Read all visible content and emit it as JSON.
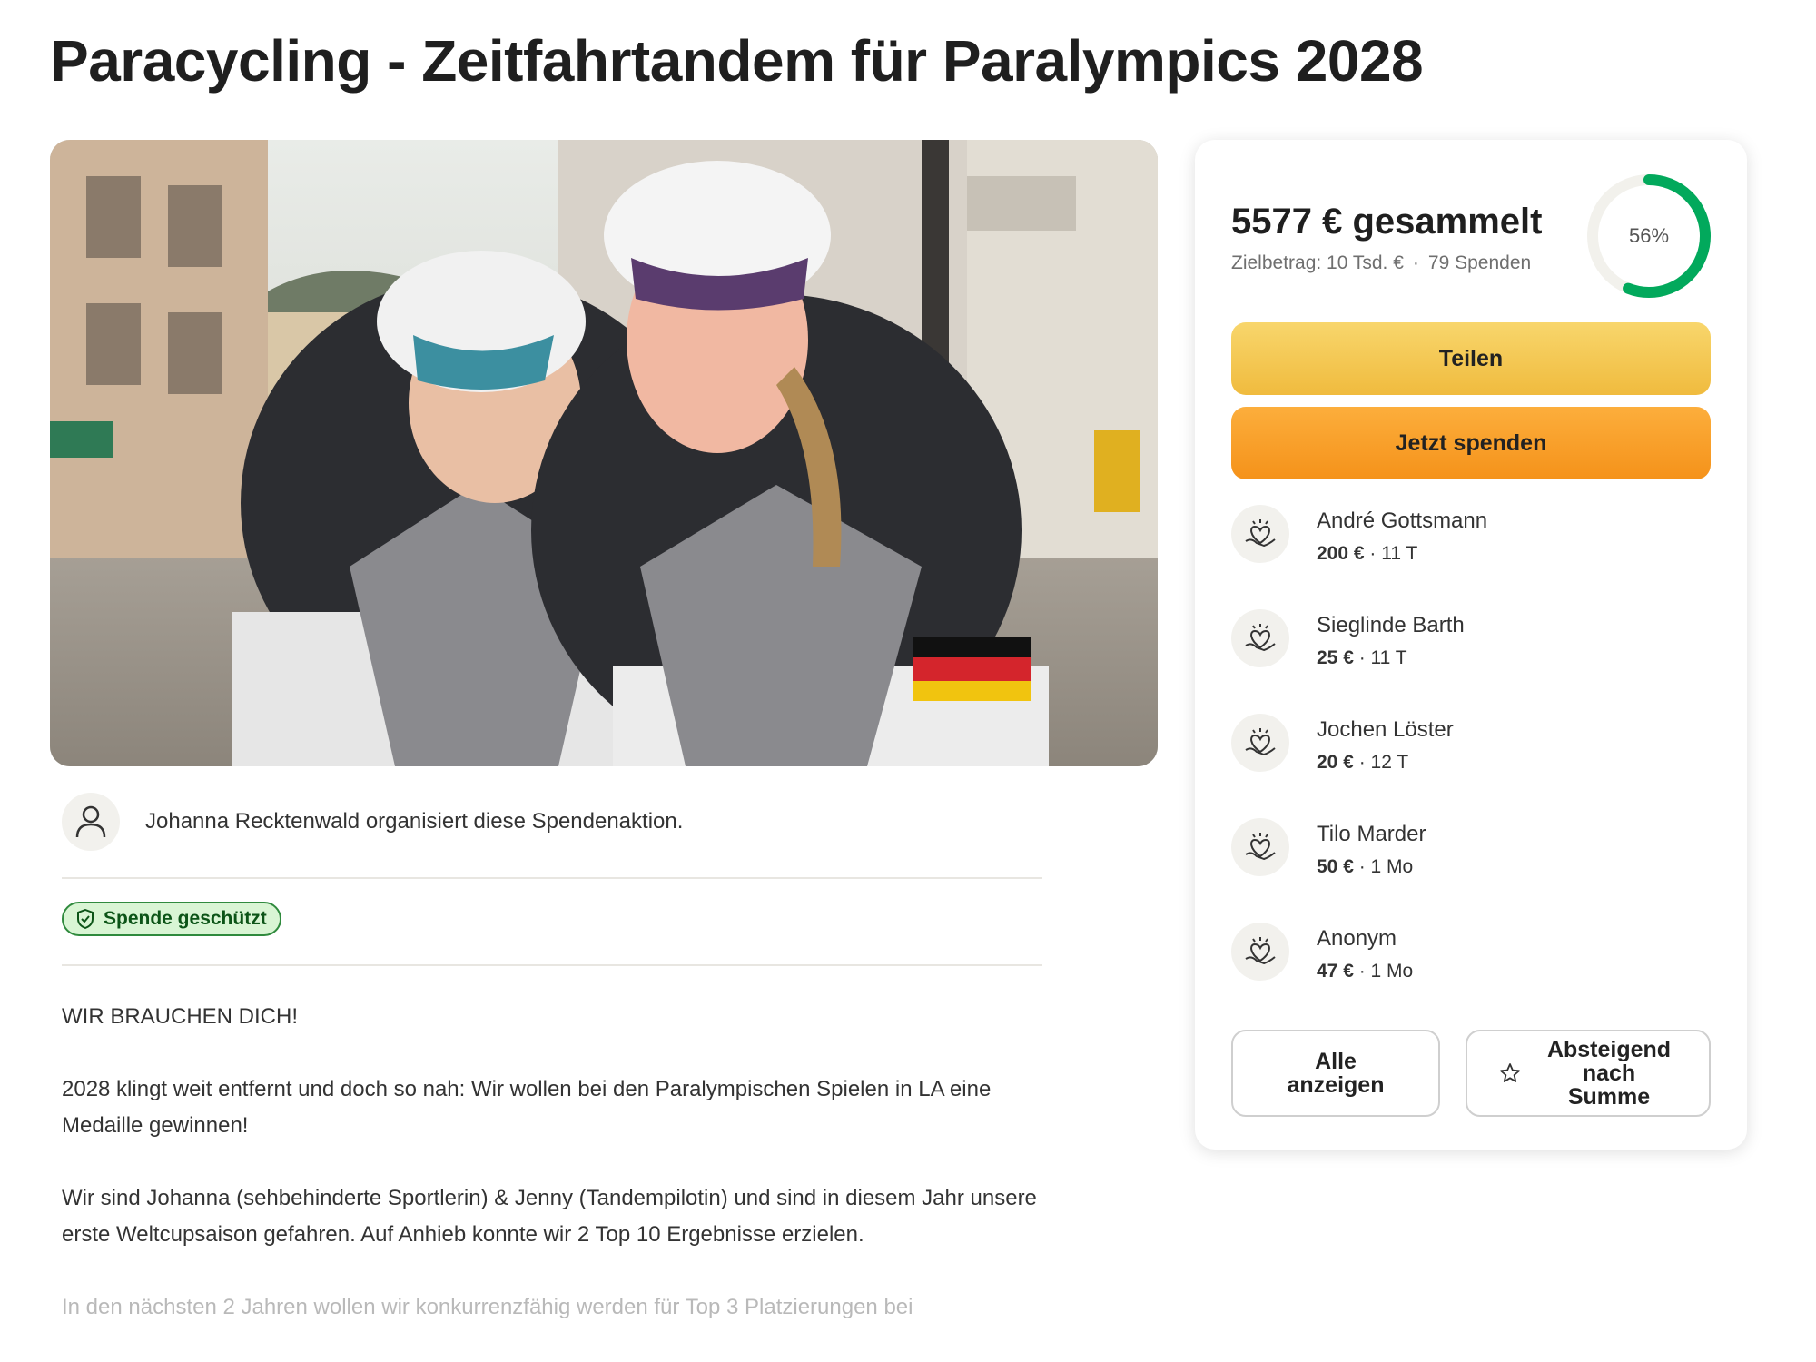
{
  "page": {
    "title": "Paracycling - Zeitfahrtandem für Paralympics 2028"
  },
  "organizer": {
    "text": "Johanna Recktenwald organisiert diese Spendenaktion."
  },
  "badge": {
    "label": "Spende geschützt"
  },
  "story": {
    "paragraphs": [
      "WIR BRAUCHEN DICH!",
      "2028 klingt weit entfernt und doch so nah: Wir wollen bei den Paralympischen Spielen in LA eine Medaille gewinnen!",
      "Wir sind Johanna (sehbehinderte Sportlerin) & Jenny (Tandempilotin) und sind in diesem Jahr unsere erste Weltcupsaison gefahren. Auf Anhieb konnte wir 2 Top 10 Ergebnisse erzielen.",
      "In den nächsten 2 Jahren wollen wir konkurrenzfähig werden für Top 3 Platzierungen bei"
    ]
  },
  "fundraiser": {
    "raised": "5577 € gesammelt",
    "goal": "Zielbetrag: 10 Tsd. €",
    "separator": "·",
    "donation_count": "79 Spenden",
    "progress_label": "56%",
    "progress_fraction": 0.56,
    "progress_color": "#02a95c",
    "share_label": "Teilen",
    "donate_label": "Jetzt spenden"
  },
  "donations": [
    {
      "name": "André Gottsmann",
      "amount": "200 €",
      "time": "· 11 T"
    },
    {
      "name": "Sieglinde Barth",
      "amount": "25 €",
      "time": "· 11 T"
    },
    {
      "name": "Jochen Löster",
      "amount": "20 €",
      "time": "· 12 T"
    },
    {
      "name": "Tilo Marder",
      "amount": "50 €",
      "time": "· 1 Mo"
    },
    {
      "name": "Anonym",
      "amount": "47 €",
      "time": "· 1 Mo"
    }
  ],
  "donation_icon": "heart-hands-icon",
  "actions": {
    "show_all": "Alle anzeigen",
    "sort": "Absteigend nach Summe"
  }
}
